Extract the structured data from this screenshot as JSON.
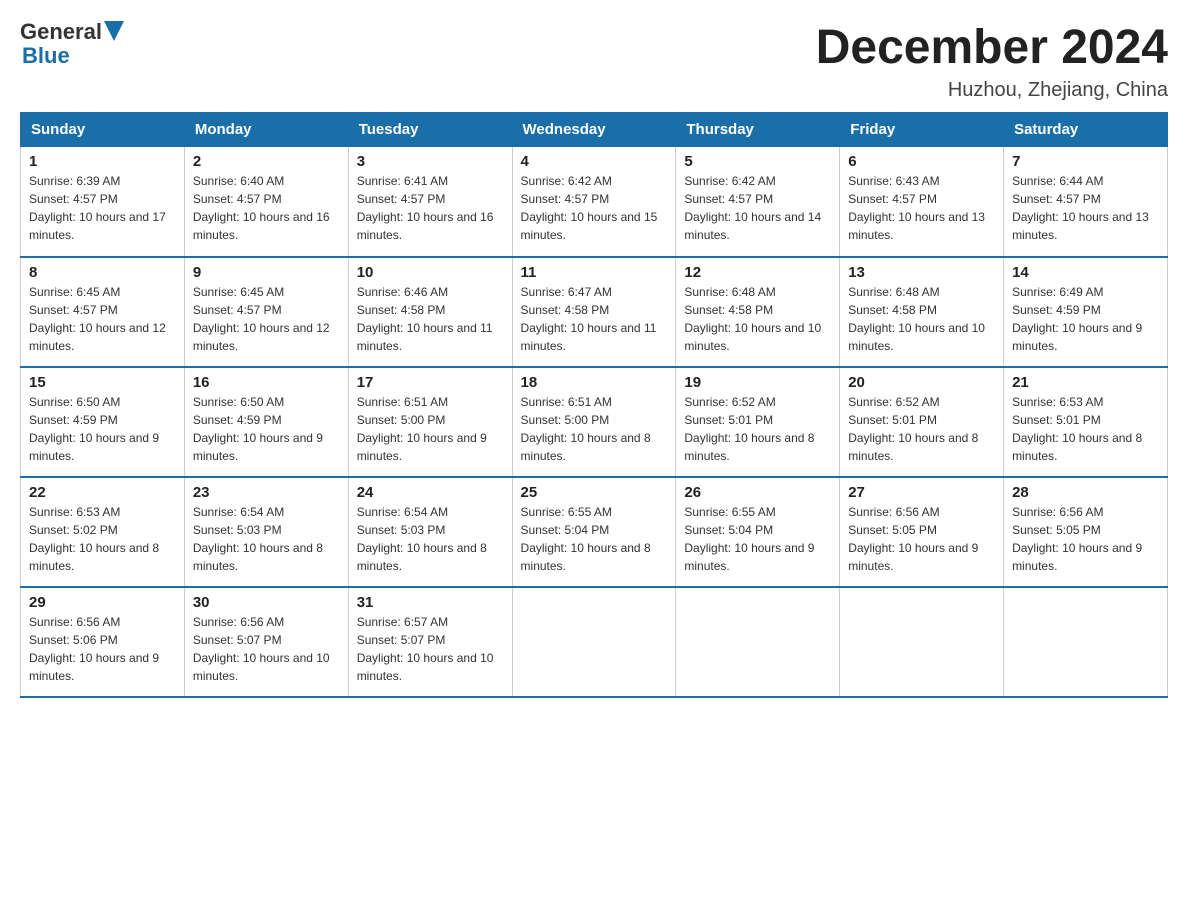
{
  "logo": {
    "text_general": "General",
    "text_blue": "Blue"
  },
  "header": {
    "month_year": "December 2024",
    "location": "Huzhou, Zhejiang, China"
  },
  "weekdays": [
    "Sunday",
    "Monday",
    "Tuesday",
    "Wednesday",
    "Thursday",
    "Friday",
    "Saturday"
  ],
  "weeks": [
    [
      {
        "day": "1",
        "sunrise": "6:39 AM",
        "sunset": "4:57 PM",
        "daylight": "10 hours and 17 minutes."
      },
      {
        "day": "2",
        "sunrise": "6:40 AM",
        "sunset": "4:57 PM",
        "daylight": "10 hours and 16 minutes."
      },
      {
        "day": "3",
        "sunrise": "6:41 AM",
        "sunset": "4:57 PM",
        "daylight": "10 hours and 16 minutes."
      },
      {
        "day": "4",
        "sunrise": "6:42 AM",
        "sunset": "4:57 PM",
        "daylight": "10 hours and 15 minutes."
      },
      {
        "day": "5",
        "sunrise": "6:42 AM",
        "sunset": "4:57 PM",
        "daylight": "10 hours and 14 minutes."
      },
      {
        "day": "6",
        "sunrise": "6:43 AM",
        "sunset": "4:57 PM",
        "daylight": "10 hours and 13 minutes."
      },
      {
        "day": "7",
        "sunrise": "6:44 AM",
        "sunset": "4:57 PM",
        "daylight": "10 hours and 13 minutes."
      }
    ],
    [
      {
        "day": "8",
        "sunrise": "6:45 AM",
        "sunset": "4:57 PM",
        "daylight": "10 hours and 12 minutes."
      },
      {
        "day": "9",
        "sunrise": "6:45 AM",
        "sunset": "4:57 PM",
        "daylight": "10 hours and 12 minutes."
      },
      {
        "day": "10",
        "sunrise": "6:46 AM",
        "sunset": "4:58 PM",
        "daylight": "10 hours and 11 minutes."
      },
      {
        "day": "11",
        "sunrise": "6:47 AM",
        "sunset": "4:58 PM",
        "daylight": "10 hours and 11 minutes."
      },
      {
        "day": "12",
        "sunrise": "6:48 AM",
        "sunset": "4:58 PM",
        "daylight": "10 hours and 10 minutes."
      },
      {
        "day": "13",
        "sunrise": "6:48 AM",
        "sunset": "4:58 PM",
        "daylight": "10 hours and 10 minutes."
      },
      {
        "day": "14",
        "sunrise": "6:49 AM",
        "sunset": "4:59 PM",
        "daylight": "10 hours and 9 minutes."
      }
    ],
    [
      {
        "day": "15",
        "sunrise": "6:50 AM",
        "sunset": "4:59 PM",
        "daylight": "10 hours and 9 minutes."
      },
      {
        "day": "16",
        "sunrise": "6:50 AM",
        "sunset": "4:59 PM",
        "daylight": "10 hours and 9 minutes."
      },
      {
        "day": "17",
        "sunrise": "6:51 AM",
        "sunset": "5:00 PM",
        "daylight": "10 hours and 9 minutes."
      },
      {
        "day": "18",
        "sunrise": "6:51 AM",
        "sunset": "5:00 PM",
        "daylight": "10 hours and 8 minutes."
      },
      {
        "day": "19",
        "sunrise": "6:52 AM",
        "sunset": "5:01 PM",
        "daylight": "10 hours and 8 minutes."
      },
      {
        "day": "20",
        "sunrise": "6:52 AM",
        "sunset": "5:01 PM",
        "daylight": "10 hours and 8 minutes."
      },
      {
        "day": "21",
        "sunrise": "6:53 AM",
        "sunset": "5:01 PM",
        "daylight": "10 hours and 8 minutes."
      }
    ],
    [
      {
        "day": "22",
        "sunrise": "6:53 AM",
        "sunset": "5:02 PM",
        "daylight": "10 hours and 8 minutes."
      },
      {
        "day": "23",
        "sunrise": "6:54 AM",
        "sunset": "5:03 PM",
        "daylight": "10 hours and 8 minutes."
      },
      {
        "day": "24",
        "sunrise": "6:54 AM",
        "sunset": "5:03 PM",
        "daylight": "10 hours and 8 minutes."
      },
      {
        "day": "25",
        "sunrise": "6:55 AM",
        "sunset": "5:04 PM",
        "daylight": "10 hours and 8 minutes."
      },
      {
        "day": "26",
        "sunrise": "6:55 AM",
        "sunset": "5:04 PM",
        "daylight": "10 hours and 9 minutes."
      },
      {
        "day": "27",
        "sunrise": "6:56 AM",
        "sunset": "5:05 PM",
        "daylight": "10 hours and 9 minutes."
      },
      {
        "day": "28",
        "sunrise": "6:56 AM",
        "sunset": "5:05 PM",
        "daylight": "10 hours and 9 minutes."
      }
    ],
    [
      {
        "day": "29",
        "sunrise": "6:56 AM",
        "sunset": "5:06 PM",
        "daylight": "10 hours and 9 minutes."
      },
      {
        "day": "30",
        "sunrise": "6:56 AM",
        "sunset": "5:07 PM",
        "daylight": "10 hours and 10 minutes."
      },
      {
        "day": "31",
        "sunrise": "6:57 AM",
        "sunset": "5:07 PM",
        "daylight": "10 hours and 10 minutes."
      },
      null,
      null,
      null,
      null
    ]
  ]
}
